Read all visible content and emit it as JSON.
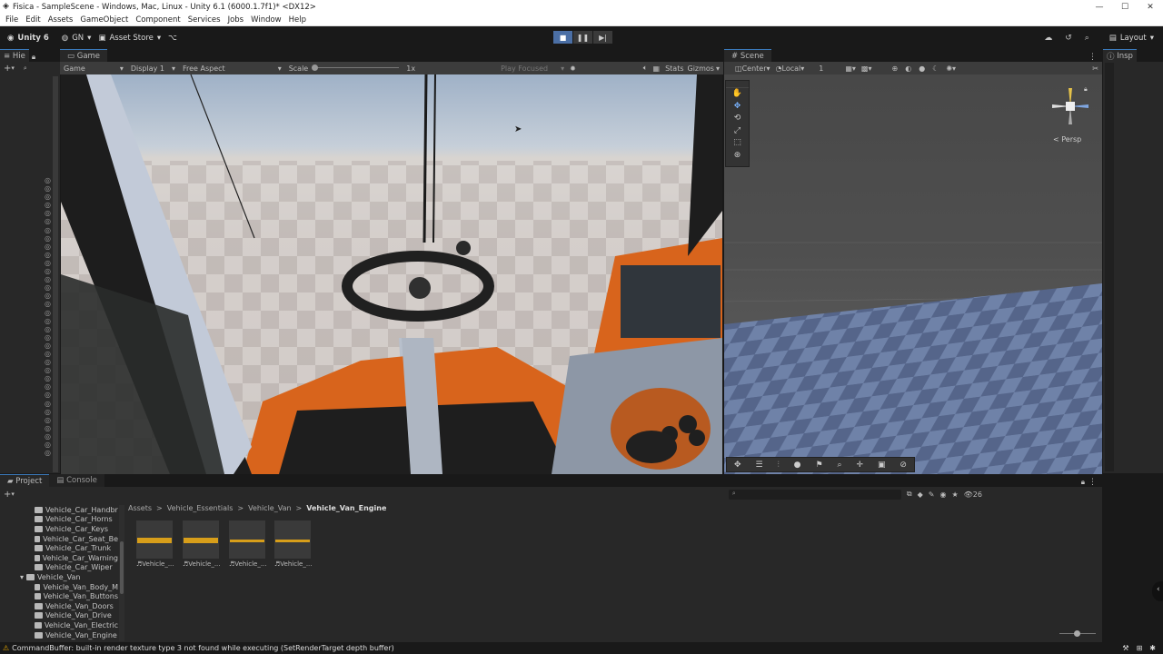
{
  "window": {
    "title": "Fisica - SampleScene - Windows, Mac, Linux - Unity 6.1 (6000.1.7f1)* <DX12>"
  },
  "menu": [
    "File",
    "Edit",
    "Assets",
    "GameObject",
    "Component",
    "Services",
    "Jobs",
    "Window",
    "Help"
  ],
  "toolbar": {
    "unity": "Unity 6",
    "account": "GN",
    "asset_store": "Asset Store",
    "layout": "Layout"
  },
  "hierarchy": {
    "tab": "Hie"
  },
  "game": {
    "tab": "Game",
    "mode": "Game",
    "display": "Display 1",
    "aspect": "Free Aspect",
    "scale_label": "Scale",
    "scale_value": "1x",
    "play_focused": "Play Focused",
    "stats": "Stats",
    "gizmos": "Gizmos"
  },
  "scene": {
    "tab": "Scene",
    "pivot": "Center",
    "space": "Local",
    "grid_value": "1",
    "persp": "< Persp"
  },
  "inspector": {
    "tab": "Insp"
  },
  "project": {
    "tab_project": "Project",
    "tab_console": "Console",
    "count": "26",
    "breadcrumb": [
      "Assets",
      "Vehicle_Essentials",
      "Vehicle_Van",
      "Vehicle_Van_Engine"
    ],
    "tree": [
      {
        "label": "Vehicle_Car_Handbr",
        "indent": 1
      },
      {
        "label": "Vehicle_Car_Horns",
        "indent": 1
      },
      {
        "label": "Vehicle_Car_Keys",
        "indent": 1
      },
      {
        "label": "Vehicle_Car_Seat_Be",
        "indent": 1
      },
      {
        "label": "Vehicle_Car_Trunk",
        "indent": 1
      },
      {
        "label": "Vehicle_Car_Warning",
        "indent": 1
      },
      {
        "label": "Vehicle_Car_Wiper",
        "indent": 1
      },
      {
        "label": "Vehicle_Van",
        "indent": 0
      },
      {
        "label": "Vehicle_Van_Body_M",
        "indent": 1
      },
      {
        "label": "Vehicle_Van_Buttons",
        "indent": 1
      },
      {
        "label": "Vehicle_Van_Doors",
        "indent": 1
      },
      {
        "label": "Vehicle_Van_Drive",
        "indent": 1
      },
      {
        "label": "Vehicle_Van_Electric",
        "indent": 1
      },
      {
        "label": "Vehicle_Van_Engine",
        "indent": 1
      }
    ],
    "assets": [
      "Vehicle_...",
      "Vehicle_...",
      "Vehicle_...",
      "Vehicle_..."
    ]
  },
  "status": {
    "message": "CommandBuffer: built-in render texture type 3 not found while executing (SetRenderTarget depth buffer)"
  },
  "colors": {
    "accent": "#3a79bb",
    "warning": "#e0a500",
    "audio_wave": "#d79e1a",
    "cab_orange": "#d8641c"
  }
}
